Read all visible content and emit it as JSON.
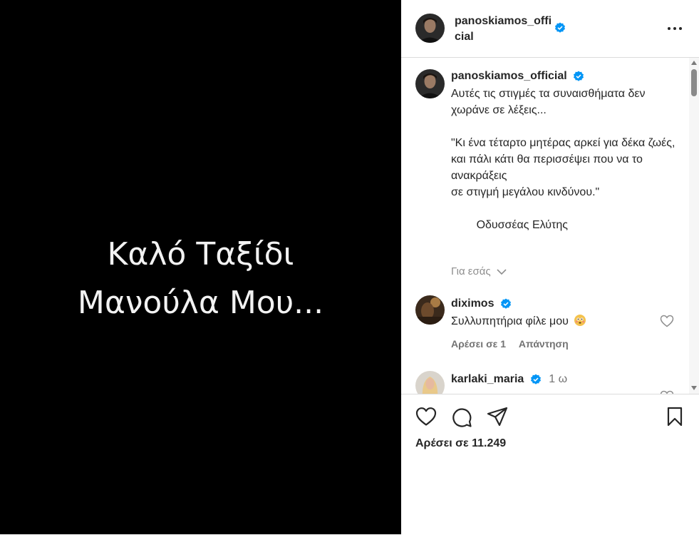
{
  "media": {
    "line1": "Καλό Ταξίδι",
    "line2": "Μανούλα Μου..."
  },
  "header": {
    "username": "panoskiamos_official",
    "verified": true,
    "more_icon": "more-horizontal-icon"
  },
  "caption": {
    "username": "panoskiamos_official",
    "text": "Αυτές τις στιγμές τα συναισθήματα δεν χωράνε σε λέξεις...\n\n\"Κι ένα τέταρτο μητέρας αρκεί για δέκα ζωές,\nκαι πάλι κάτι θα περισσέψει που να το ανακράξεις\nσε στιγμή μεγάλου κινδύνου.\"\n\n        Οδυσσέας Ελύτης",
    "see_more": "Για εσάς"
  },
  "comments": [
    {
      "username": "diximos",
      "verified": true,
      "time": "",
      "text": "Συλλυπητήρια φίλε μου",
      "likes_label": "Αρέσει σε 1",
      "reply_label": "Απάντηση"
    },
    {
      "username": "karlaki_maria",
      "verified": true,
      "time": "1 ω",
      "text": "",
      "likes_label": "",
      "reply_label": ""
    }
  ],
  "actions": {
    "icons": [
      "heart-icon",
      "comment-icon",
      "share-icon",
      "save-icon"
    ],
    "likes": "Αρέσει σε 11.249"
  },
  "colors": {
    "verified": "#0095f6",
    "muted": "#737373",
    "divider": "#dbdbdb"
  }
}
